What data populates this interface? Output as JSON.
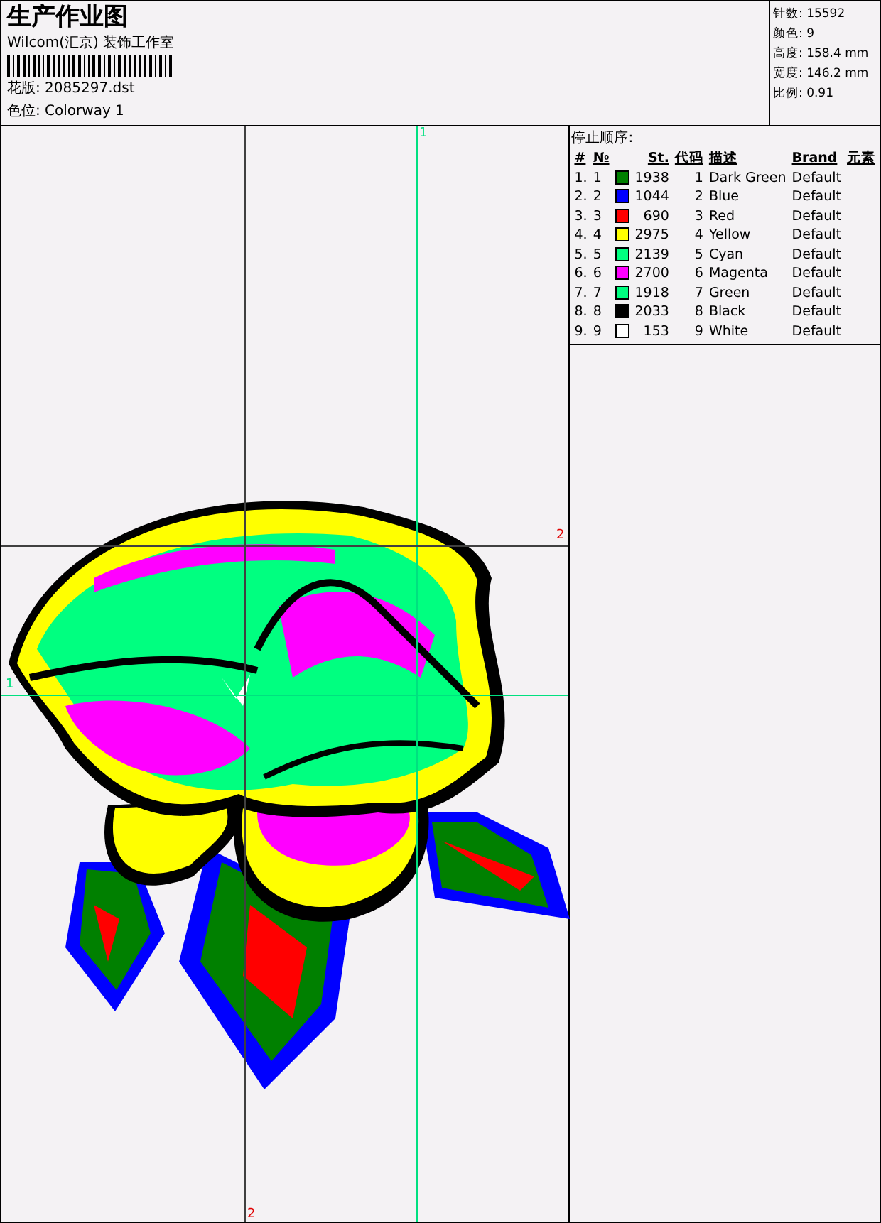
{
  "header": {
    "title": "生产作业图",
    "company": "Wilcom(汇京) 装饰工作室",
    "design": "花版: 2085297.dst",
    "colorway": "色位: Colorway 1"
  },
  "stats": [
    "针数: 15592",
    "颜色: 9",
    "高度: 158.4 mm",
    "宽度: 146.2 mm",
    "比例: 0.91"
  ],
  "guides": [
    {
      "label": "1",
      "kind": "vertical",
      "color": "#00e080"
    },
    {
      "label": "2",
      "kind": "vertical",
      "color": "#404040"
    },
    {
      "label": "2",
      "kind": "horizontal",
      "color": "#404040"
    },
    {
      "label": "1",
      "kind": "horizontal",
      "color": "#00e080"
    }
  ],
  "stop_sequence": {
    "title": "停止顺序:",
    "columns": [
      "#",
      "№",
      "St.",
      "代码",
      "描述",
      "Brand",
      "元素"
    ],
    "rows": [
      {
        "index": "1.",
        "no": "1",
        "color": "#008000",
        "stitches": "1938",
        "code": "1",
        "description": "Dark Green",
        "brand": "Default"
      },
      {
        "index": "2.",
        "no": "2",
        "color": "#0000ff",
        "stitches": "1044",
        "code": "2",
        "description": "Blue",
        "brand": "Default"
      },
      {
        "index": "3.",
        "no": "3",
        "color": "#ff0000",
        "stitches": "690",
        "code": "3",
        "description": "Red",
        "brand": "Default"
      },
      {
        "index": "4.",
        "no": "4",
        "color": "#ffff00",
        "stitches": "2975",
        "code": "4",
        "description": "Yellow",
        "brand": "Default"
      },
      {
        "index": "5.",
        "no": "5",
        "color": "#00ff80",
        "stitches": "2139",
        "code": "5",
        "description": "Cyan",
        "brand": "Default"
      },
      {
        "index": "6.",
        "no": "6",
        "color": "#ff00ff",
        "stitches": "2700",
        "code": "6",
        "description": "Magenta",
        "brand": "Default"
      },
      {
        "index": "7.",
        "no": "7",
        "color": "#00ff80",
        "stitches": "1918",
        "code": "7",
        "description": "Green",
        "brand": "Default"
      },
      {
        "index": "8.",
        "no": "8",
        "color": "#000000",
        "stitches": "2033",
        "code": "8",
        "description": "Black",
        "brand": "Default"
      },
      {
        "index": "9.",
        "no": "9",
        "color": "#ffffff",
        "stitches": "153",
        "code": "9",
        "description": "White",
        "brand": "Default"
      }
    ]
  }
}
